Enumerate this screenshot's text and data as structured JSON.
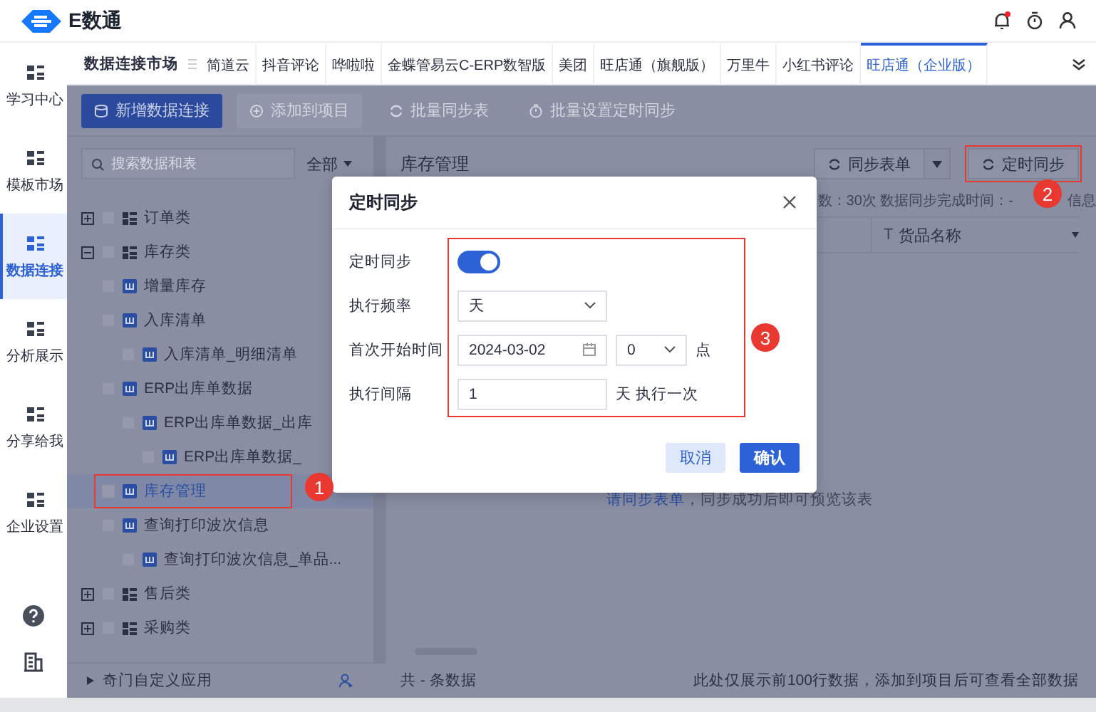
{
  "header": {
    "app_name": "E数通"
  },
  "sidebar": {
    "items": [
      {
        "label": "学习中心",
        "selected": false
      },
      {
        "label": "模板市场",
        "selected": false
      },
      {
        "label": "数据连接",
        "selected": true
      },
      {
        "label": "分析展示",
        "selected": false
      },
      {
        "label": "分享给我",
        "selected": false
      },
      {
        "label": "企业设置",
        "selected": false
      }
    ]
  },
  "tab_bar": {
    "title": "数据连接市场",
    "tabs": [
      {
        "label": "简道云",
        "selected": false
      },
      {
        "label": "抖音评论",
        "selected": false
      },
      {
        "label": "哗啦啦",
        "selected": false
      },
      {
        "label": "金蝶管易云C-ERP数智版",
        "selected": false
      },
      {
        "label": "美团",
        "selected": false
      },
      {
        "label": "旺店通（旗舰版）",
        "selected": false
      },
      {
        "label": "万里牛",
        "selected": false
      },
      {
        "label": "小红书评论",
        "selected": false
      },
      {
        "label": "旺店通（企业版）",
        "selected": true
      }
    ]
  },
  "toolbar": {
    "buttons": [
      {
        "label": "新增数据连接",
        "kind": "primary",
        "disabled": false
      },
      {
        "label": "添加到项目",
        "kind": "add",
        "disabled": true
      },
      {
        "label": "批量同步表",
        "kind": "sync",
        "disabled": true
      },
      {
        "label": "批量设置定时同步",
        "kind": "timer",
        "disabled": true
      }
    ]
  },
  "tree_panel": {
    "search": {
      "placeholder": "搜索数据和表"
    },
    "filter": "全部",
    "items": [
      {
        "label": "订单类",
        "kind": "group",
        "expanded": false,
        "selected": false
      },
      {
        "label": "库存类",
        "kind": "group",
        "expanded": true,
        "selected": false,
        "children": [
          {
            "label": "增量库存",
            "kind": "table",
            "selected": false
          },
          {
            "label": "入库清单",
            "kind": "table",
            "selected": false,
            "children": [
              {
                "label": "入库清单_明细清单",
                "kind": "table",
                "selected": false
              }
            ]
          },
          {
            "label": "ERP出库单数据",
            "kind": "table",
            "selected": false,
            "children": [
              {
                "label": "ERP出库单数据_出库",
                "kind": "table",
                "selected": false,
                "children": [
                  {
                    "label": "ERP出库单数据_",
                    "kind": "table",
                    "selected": false
                  }
                ]
              }
            ]
          },
          {
            "label": "库存管理",
            "kind": "table",
            "selected": true,
            "annotation": "1"
          },
          {
            "label": "查询打印波次信息",
            "kind": "table",
            "selected": false,
            "children": [
              {
                "label": "查询打印波次信息_单品...",
                "kind": "table",
                "selected": false
              }
            ]
          }
        ]
      },
      {
        "label": "售后类",
        "kind": "group",
        "expanded": false,
        "selected": false
      },
      {
        "label": "采购类",
        "kind": "group",
        "expanded": false,
        "selected": false
      }
    ],
    "footer": "奇门自定义应用"
  },
  "content": {
    "title": "库存管理",
    "buttons": [
      {
        "label": "同步表单",
        "kind": "split"
      },
      {
        "label": "定时同步",
        "kind": "plain",
        "annotation": "2"
      }
    ],
    "info": "数：30次  数据同步完成时间：-",
    "info_tail": "信息",
    "columns": [
      {
        "label": "货品名称",
        "type_mark": "T"
      }
    ],
    "empty_link": "请同步表单",
    "empty_text": "，同步成功后即可预览该表",
    "count": "共  -  条数据",
    "note": "此处仅展示前100行数据，添加到项目后可查看全部数据"
  },
  "dialog": {
    "title": "定时同步",
    "annotation": "3",
    "fields": [
      {
        "label": "定时同步",
        "kind": "switch",
        "on": true
      },
      {
        "label": "执行频率",
        "kind": "select",
        "value": "天"
      },
      {
        "label": "首次开始时间",
        "kind": "datetime",
        "date": "2024-03-02",
        "hour": "0",
        "unit": "点"
      },
      {
        "label": "执行间隔",
        "kind": "number",
        "value": "1",
        "suffix": "天 执行一次"
      }
    ],
    "buttons": [
      {
        "label": "取消",
        "kind": "secondary"
      },
      {
        "label": "确认",
        "kind": "primary"
      }
    ]
  }
}
